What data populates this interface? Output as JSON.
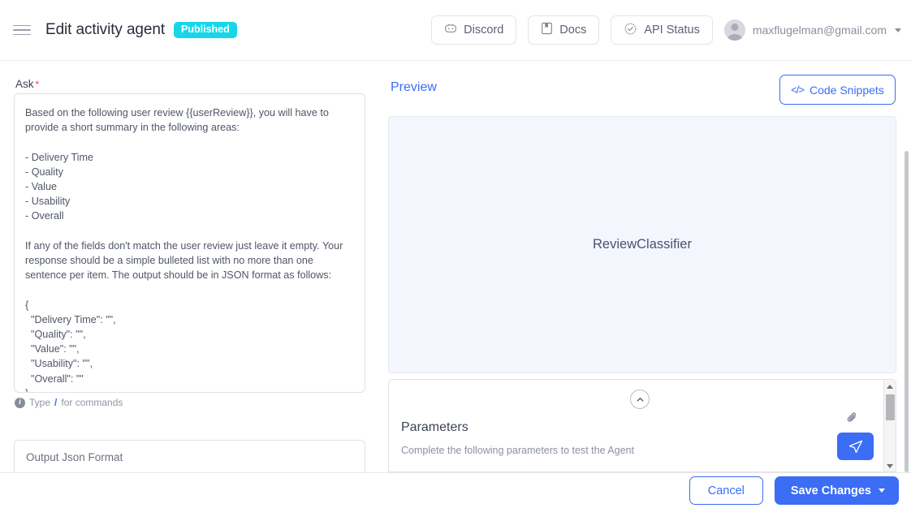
{
  "header": {
    "menu_icon": "hamburger-icon",
    "title": "Edit activity agent",
    "status_badge": "Published",
    "buttons": [
      {
        "label": "Discord",
        "icon": "discord-icon"
      },
      {
        "label": "Docs",
        "icon": "book-icon"
      },
      {
        "label": "API Status",
        "icon": "check-badge-icon"
      }
    ],
    "user": {
      "email": "maxflugelman@gmail.com",
      "avatar_icon": "user-avatar",
      "caret_icon": "chevron-down-icon"
    }
  },
  "editor": {
    "ask_label": "Ask",
    "required_mark": "*",
    "ask_value": "Based on the following user review {{userReview}}, you will have to provide a short summary in the following areas:\n\n- Delivery Time\n- Quality\n- Value\n- Usability\n- Overall\n\nIf any of the fields don't match the user review just leave it empty. Your response should be a simple bulleted list with no more than one sentence per item. The output should be in JSON format as follows:\n\n{\n  \"Delivery Time\": \"\",\n  \"Quality\": \"\",\n  \"Value\": \"\",\n  \"Usability\": \"\",\n  \"Overall\": \"\"\n}",
    "hint_prefix": "Type",
    "hint_slash": "/",
    "hint_suffix": "for commands",
    "hint_icon": "info-icon",
    "output_field_label": "Output Json Format"
  },
  "preview": {
    "title": "Preview",
    "code_snippets_button": "Code Snippets",
    "code_icon": "code-brackets-icon",
    "agent_name": "ReviewClassifier",
    "panel_bg": "#f3f6fd"
  },
  "parameters": {
    "collapse_icon": "chevron-up-icon",
    "title": "Parameters",
    "subtitle": "Complete the following parameters to test the Agent",
    "attach_icon": "paperclip-icon",
    "send_icon": "send-icon"
  },
  "footer": {
    "cancel_label": "Cancel",
    "save_label": "Save Changes",
    "save_caret_icon": "caret-down-icon"
  },
  "colors": {
    "accent_blue": "#3b6df5",
    "badge_cyan": "#16d7ea",
    "required_red": "#ef4444"
  }
}
